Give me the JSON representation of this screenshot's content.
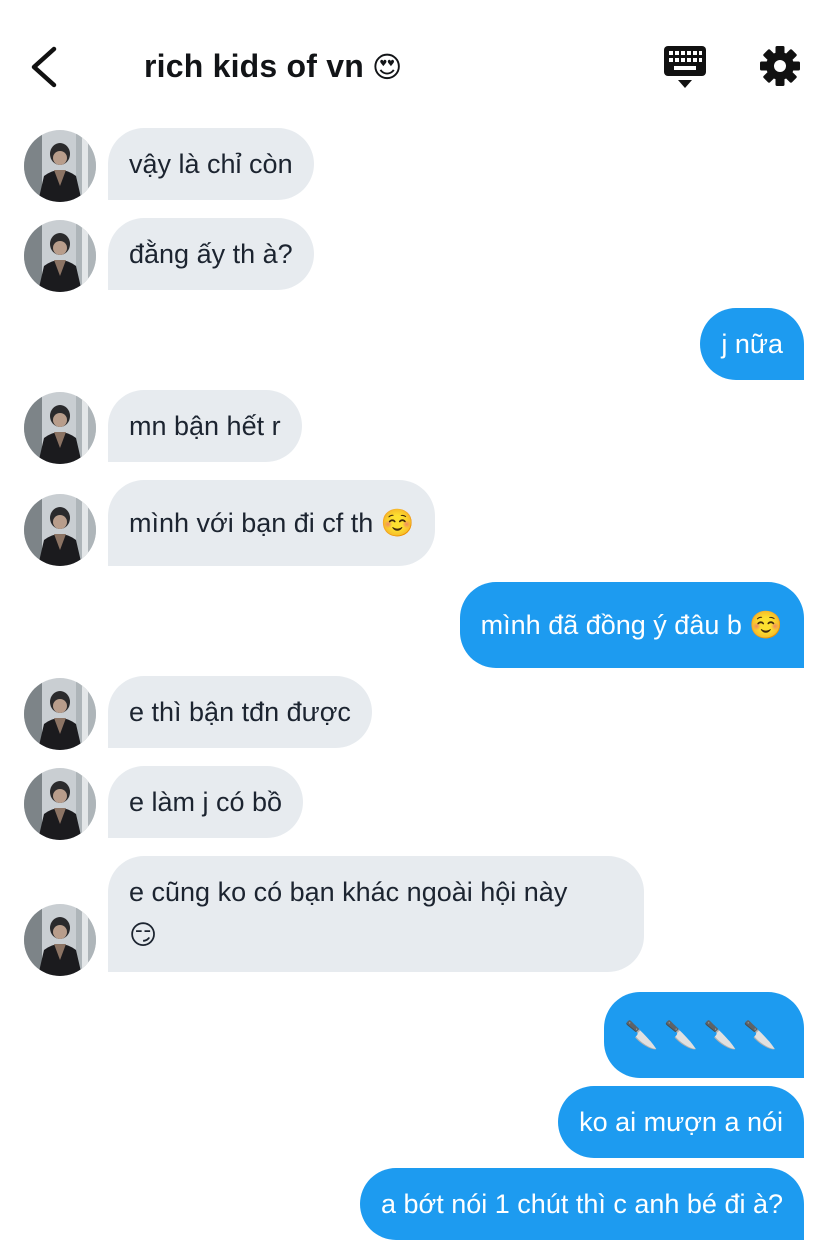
{
  "header": {
    "title": "rich kids of vn",
    "title_emoji": "😍",
    "back_icon": "chevron-left-icon",
    "keyboard_icon": "keyboard-icon",
    "settings_icon": "gear-icon"
  },
  "colors": {
    "incoming_bubble": "#e7ebef",
    "outgoing_bubble": "#1d9bf0",
    "text_dark": "#1c2430"
  },
  "messages": [
    {
      "side": "in",
      "text": "vậy là chỉ còn"
    },
    {
      "side": "in",
      "text": "đằng ấy th à?"
    },
    {
      "side": "out",
      "text": "j nữa"
    },
    {
      "side": "in",
      "text": "mn bận hết r"
    },
    {
      "side": "in",
      "text": "mình với bạn đi cf th ☺️"
    },
    {
      "side": "out",
      "text": "mình đã đồng ý đâu b ☺️"
    },
    {
      "side": "in",
      "text": "e thì bận tđn được"
    },
    {
      "side": "in",
      "text": "e làm j có bồ"
    },
    {
      "side": "in",
      "text": "e cũng ko có bạn khác ngoài hội này",
      "text2": "😏"
    },
    {
      "side": "out",
      "text": "🔪🔪🔪🔪"
    },
    {
      "side": "out",
      "text": "ko ai mượn a nói"
    },
    {
      "side": "out",
      "text": "a bớt nói 1 chút thì c anh bé đi à?"
    }
  ]
}
